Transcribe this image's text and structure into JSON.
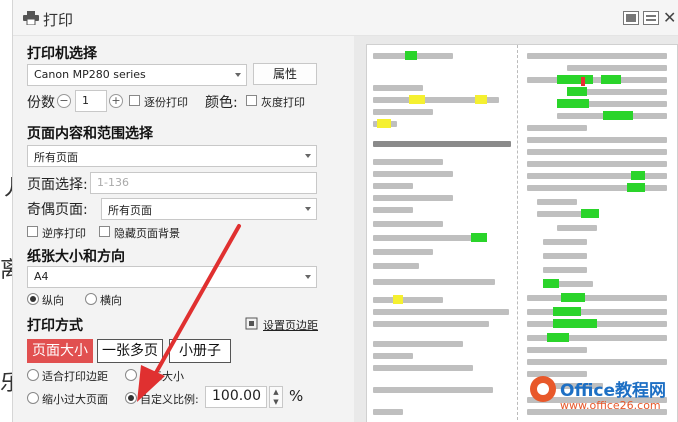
{
  "window": {
    "title": "打印"
  },
  "printer": {
    "section_title": "打印机选择",
    "selected": "Canon MP280 series",
    "properties_label": "属性",
    "copies_label": "份数",
    "copies_value": "1",
    "minus": "−",
    "plus": "+",
    "collate_label": "逐份打印",
    "color_label": "颜色:",
    "grayscale_label": "灰度打印"
  },
  "range": {
    "section_title": "页面内容和范围选择",
    "content_selected": "所有页面",
    "page_select_label": "页面选择:",
    "page_select_placeholder": "1-136",
    "odd_even_label": "奇偶页面:",
    "odd_even_selected": "所有页面",
    "reverse_label": "逆序打印",
    "hide_bg_label": "隐藏页面背景"
  },
  "paper": {
    "section_title": "纸张大小和方向",
    "size_selected": "A4",
    "portrait_label": "纵向",
    "landscape_label": "横向"
  },
  "mode": {
    "section_title": "打印方式",
    "margin_link": "设置页边距",
    "tabs": [
      "页面大小",
      "一张多页",
      "小册子"
    ],
    "fit_margin_label": "适合打印边距",
    "actual_size_label": "实际大小",
    "shrink_label": "缩小过大页面",
    "custom_scale_label": "自定义比例:",
    "scale_value": "100.00",
    "percent": "%"
  },
  "watermark": {
    "brand": "Office教程网",
    "url": "www.office26.com"
  },
  "colors": {
    "accent": "#e15050",
    "arrow": "#e03030",
    "highlight_green": "#2ad42a",
    "highlight_yellow": "#f5f030"
  }
}
